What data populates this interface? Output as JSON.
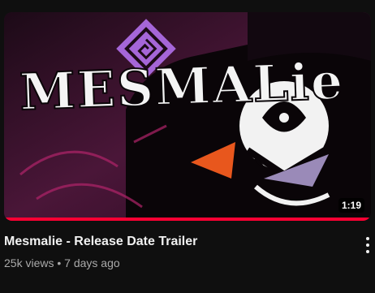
{
  "video": {
    "thumbnail_text": "MESMALie",
    "duration": "1:19",
    "watch_progress_percent": 100,
    "title": "Mesmalie - Release Date Trailer",
    "views": "25k views",
    "separator": "•",
    "age": "7 days ago",
    "menu_icon": "more-vertical-icon"
  },
  "colors": {
    "background": "#0f0f0f",
    "progress": "#ff0033",
    "title": "#f1f1f1",
    "meta": "#aaaaaa",
    "thumb_bg": "#2a0f22",
    "sigil": "#a566d8"
  }
}
